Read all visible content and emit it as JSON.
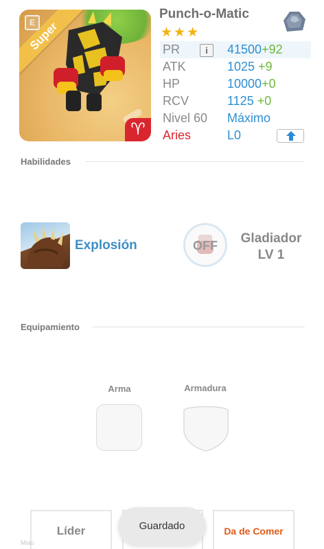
{
  "monster": {
    "name": "Punch-o-Matic",
    "stars": "★★★",
    "rarity_ribbon": "Super",
    "zodiac_symbol": "♈",
    "element_icon": "metal-element-icon",
    "card_icon_glyph": "E"
  },
  "stats": {
    "pr": {
      "label": "PR",
      "value": "41500",
      "bonus": "+92",
      "info_glyph": "i"
    },
    "atk": {
      "label": "ATK",
      "value": "1025",
      "bonus": "+9"
    },
    "hp": {
      "label": "HP",
      "value": "10000",
      "bonus": "+0"
    },
    "rcv": {
      "label": "RCV",
      "value": "1125",
      "bonus": "+0"
    },
    "level": {
      "label": "Nivel 60",
      "value": "Máximo"
    },
    "zodiac": {
      "label": "Aries",
      "value": "L0"
    }
  },
  "skills": {
    "section_title": "Habilidades",
    "active_name": "Explosión",
    "passive_status": "OFF",
    "passive_name_line1": "Gladiador",
    "passive_name_line2": "LV 1"
  },
  "equipment": {
    "section_title": "Equipamiento",
    "weapon_label": "Arma",
    "armor_label": "Armadura"
  },
  "bottom_bar": {
    "leader_label": "Líder",
    "feed_label": "Da de Comer"
  },
  "toast": {
    "text": "Guardado"
  },
  "watermark": "Miao",
  "colors": {
    "stat_value": "#2e8fd1",
    "stat_bonus": "#6db93a",
    "zodiac_red": "#d9262e",
    "star_gold": "#f2b312",
    "feed_orange": "#e05a18"
  }
}
